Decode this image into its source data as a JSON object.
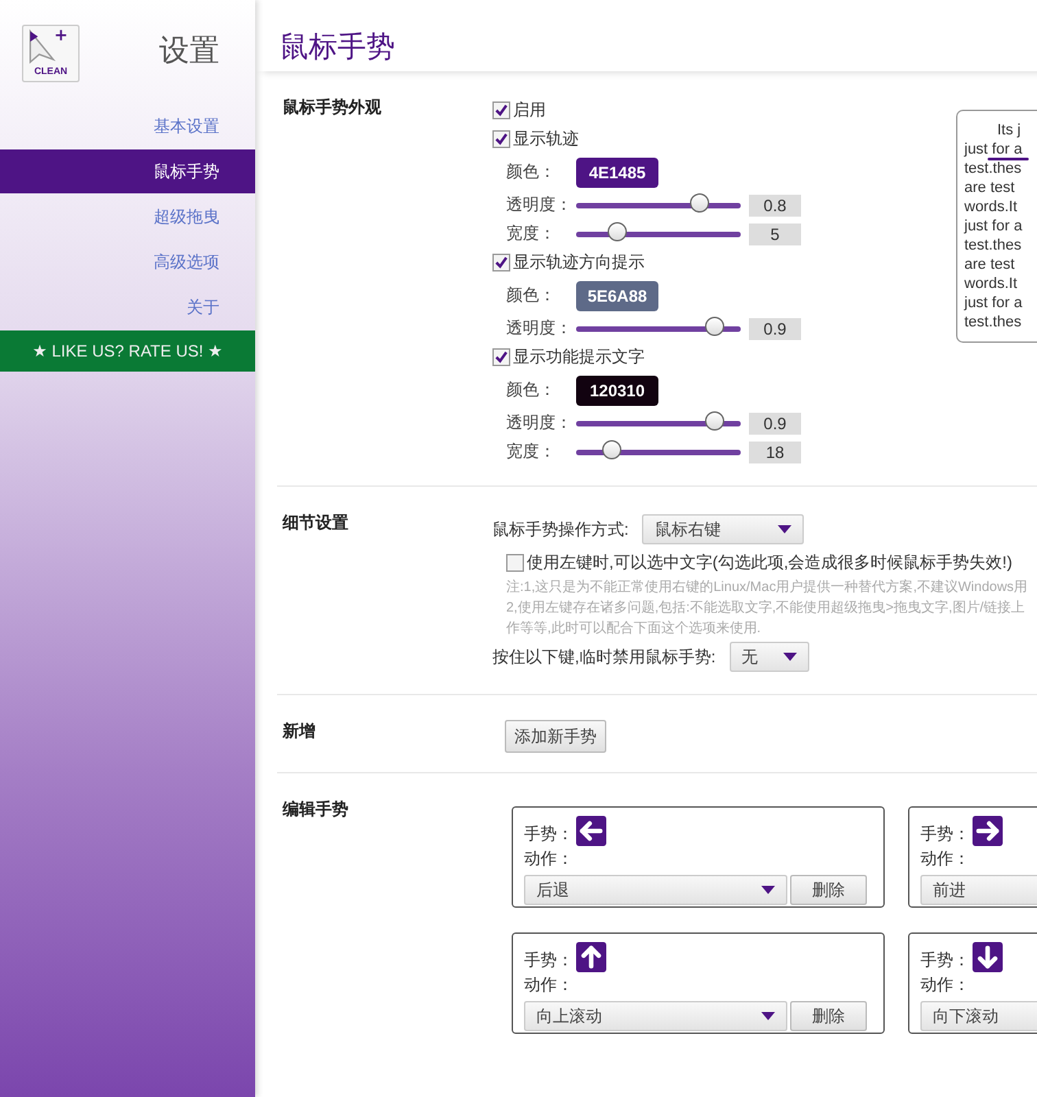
{
  "sidebar": {
    "logo_text": "CLEAN",
    "title": "设置",
    "items": [
      {
        "label": "基本设置",
        "selected": false
      },
      {
        "label": "鼠标手势",
        "selected": true
      },
      {
        "label": "超级拖曳",
        "selected": false
      },
      {
        "label": "高级选项",
        "selected": false
      },
      {
        "label": "关于",
        "selected": false
      }
    ],
    "rate_button": "★ LIKE US? RATE US! ★"
  },
  "main": {
    "title": "鼠标手势",
    "appearance": {
      "label": "鼠标手势外观",
      "options": [
        {
          "kind": "checkbox",
          "label": "启用",
          "checked": true
        },
        {
          "kind": "checkbox",
          "label": "显示轨迹",
          "checked": true
        },
        {
          "kind": "color",
          "label": "颜色：",
          "value": "4E1485",
          "color": "#4e1485"
        },
        {
          "kind": "slider",
          "label": "透明度：",
          "level": 0.8,
          "reading": "0.8"
        },
        {
          "kind": "slider",
          "label": "宽度：",
          "level": 0.22,
          "reading": "5"
        },
        {
          "kind": "checkbox",
          "label": "显示轨迹方向提示",
          "checked": true
        },
        {
          "kind": "color",
          "label": "颜色：",
          "value": "5E6A88",
          "color": "#5e6a88"
        },
        {
          "kind": "slider",
          "label": "透明度：",
          "level": 0.9,
          "reading": "0.9"
        },
        {
          "kind": "checkbox",
          "label": "显示功能提示文字",
          "checked": true
        },
        {
          "kind": "color",
          "label": "颜色：",
          "value": "120310",
          "color": "#120310"
        },
        {
          "kind": "slider",
          "label": "透明度：",
          "level": 0.9,
          "reading": "0.9"
        },
        {
          "kind": "slider",
          "label": "宽度：",
          "level": 0.18,
          "reading": "18"
        }
      ],
      "preview_lines": [
        "Its j",
        "just for a",
        "test.thes",
        "are test",
        "words.It",
        "just for a",
        "test.thes",
        "are test",
        "words.It",
        "just for a",
        "test.thes"
      ]
    },
    "details": {
      "label": "细节设置",
      "operation": {
        "label": "鼠标手势操作方式:",
        "value": "鼠标右键"
      },
      "left_select": {
        "label": "使用左键时,可以选中文字(勾选此项,会造成很多时候鼠标手势失效!)",
        "checked": false
      },
      "notes": [
        "注:1,这只是为不能正常使用右键的Linux/Mac用户提供一种替代方案,不建议Windows用",
        "2,使用左键存在诸多问题,包括:不能选取文字,不能使用超级拖曳>拖曳文字,图片/链接上",
        "作等等,此时可以配合下面这个选项来使用."
      ],
      "disable_key": {
        "label": "按住以下键,临时禁用鼠标手势:",
        "value": "无"
      }
    },
    "add": {
      "label": "新增",
      "button": "添加新手势"
    },
    "edit": {
      "label": "编辑手势",
      "gestures": [
        {
          "gesture_label": "手势：",
          "kind": "left",
          "action_label": "动作：",
          "action": "后退",
          "delete": "删除"
        },
        {
          "gesture_label": "手势：",
          "kind": "right",
          "action_label": "动作：",
          "action": "前进"
        },
        {
          "gesture_label": "手势：",
          "kind": "up",
          "action_label": "动作：",
          "action": "向上滚动",
          "delete": "删除"
        },
        {
          "gesture_label": "手势：",
          "kind": "down",
          "action_label": "动作：",
          "action": "向下滚动"
        }
      ]
    }
  }
}
